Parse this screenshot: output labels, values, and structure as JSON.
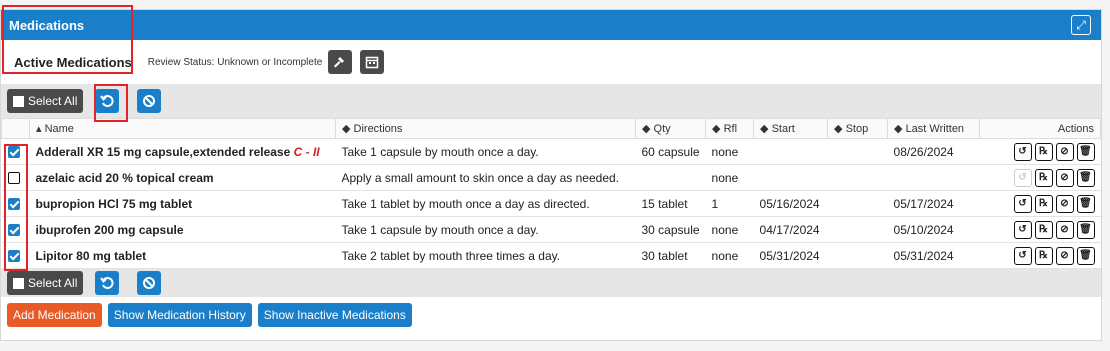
{
  "header": {
    "title": "Medications"
  },
  "sub": {
    "active_title": "Active Medications",
    "review_label": "Review Status:",
    "review_value": "Unknown or Incomplete"
  },
  "toolbar": {
    "select_all": "Select All"
  },
  "columns": [
    "Name",
    "Directions",
    "Qty",
    "Rfl",
    "Start",
    "Stop",
    "Last Written",
    "Actions"
  ],
  "rows": [
    {
      "checked": true,
      "name": "Adderall XR 15 mg capsule,extended release",
      "schedule": "C - II",
      "directions": "Take 1 capsule by mouth once a day.",
      "qty": "60 capsule",
      "rfl": "none",
      "start": "",
      "stop": "",
      "last": "08/26/2024",
      "renew_enabled": true
    },
    {
      "checked": false,
      "name": "azelaic acid 20 % topical cream",
      "schedule": "",
      "directions": "Apply a small amount to skin once a day as needed.",
      "qty": "",
      "rfl": "none",
      "start": "",
      "stop": "",
      "last": "",
      "renew_enabled": false
    },
    {
      "checked": true,
      "name": "bupropion HCl 75 mg tablet",
      "schedule": "",
      "directions": "Take 1 tablet by mouth once a day as directed.",
      "qty": "15 tablet",
      "rfl": "1",
      "start": "05/16/2024",
      "stop": "",
      "last": "05/17/2024",
      "renew_enabled": true
    },
    {
      "checked": true,
      "name": "ibuprofen 200 mg capsule",
      "schedule": "",
      "directions": "Take 1 capsule by mouth once a day.",
      "qty": "30 capsule",
      "rfl": "none",
      "start": "04/17/2024",
      "stop": "",
      "last": "05/10/2024",
      "renew_enabled": true
    },
    {
      "checked": true,
      "name": "Lipitor 80 mg tablet",
      "schedule": "",
      "directions": "Take 2 tablet by mouth three times a day.",
      "qty": "30 tablet",
      "rfl": "none",
      "start": "05/31/2024",
      "stop": "",
      "last": "05/31/2024",
      "renew_enabled": true
    }
  ],
  "footer": {
    "add": "Add Medication",
    "history": "Show Medication History",
    "inactive": "Show Inactive Medications"
  },
  "colors": {
    "brand": "#1a7fc8",
    "accent": "#e85a26",
    "highlight": "#e0242a"
  }
}
